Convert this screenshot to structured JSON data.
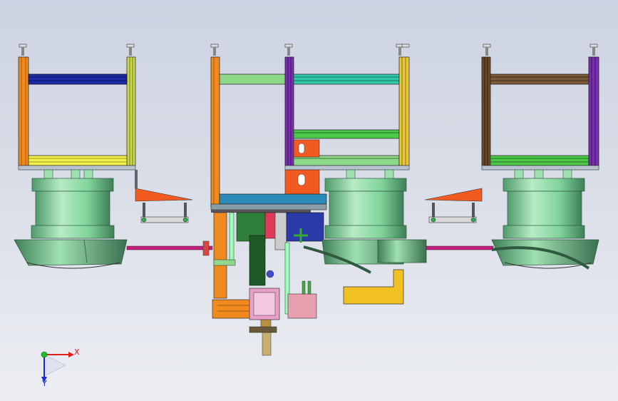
{
  "viewport": {
    "background_top": "#cdd3e2",
    "background_bottom": "#eceef2"
  },
  "triad": {
    "x_label": "X",
    "y_label": "Y",
    "x_color": "#e0201c",
    "y_color": "#1a2bd6",
    "origin_color": "#1fbf2a"
  },
  "colors": {
    "bowl": "#7fd39a",
    "bowl_dark": "#4f9a6c",
    "orange": "#f08a1e",
    "purple": "#7a2fb0",
    "blue": "#1f2aa8",
    "yellow": "#e8e83a",
    "green_light": "#8fd88a",
    "brown": "#6b4a2a",
    "magenta": "#c0207a",
    "cyan": "#30b8c8"
  }
}
